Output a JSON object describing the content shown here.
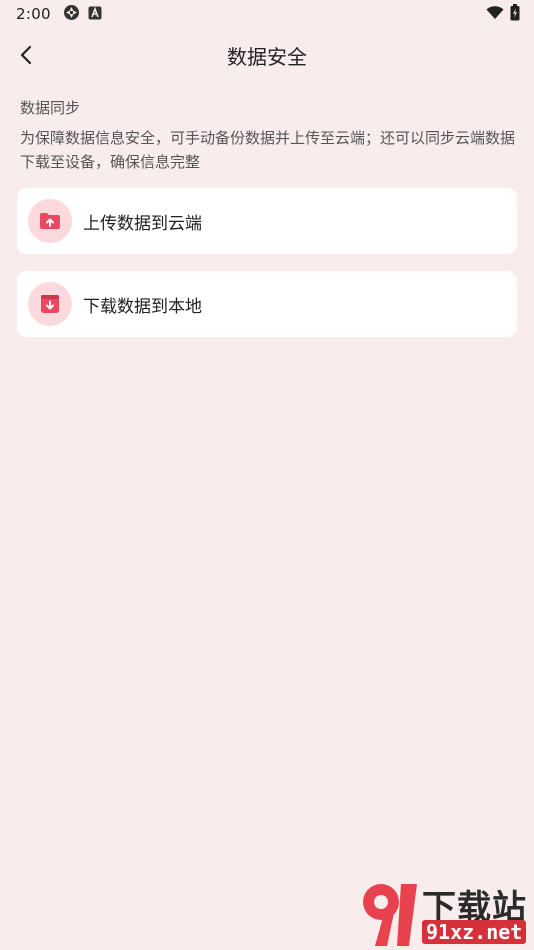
{
  "status_bar": {
    "time": "2:00"
  },
  "header": {
    "title": "数据安全"
  },
  "sync_section": {
    "title": "数据同步",
    "description": "为保障数据信息安全，可手动备份数据并上传至云端；还可以同步云端数据下载至设备，确保信息完整"
  },
  "actions": {
    "upload_label": "上传数据到云端",
    "download_label": "下载数据到本地"
  },
  "watermark": {
    "brand": "下载站",
    "url": "91xz.net"
  },
  "colors": {
    "background": "#f8eced",
    "accent": "#e84a5f",
    "icon_bg": "#fbd9dd"
  }
}
